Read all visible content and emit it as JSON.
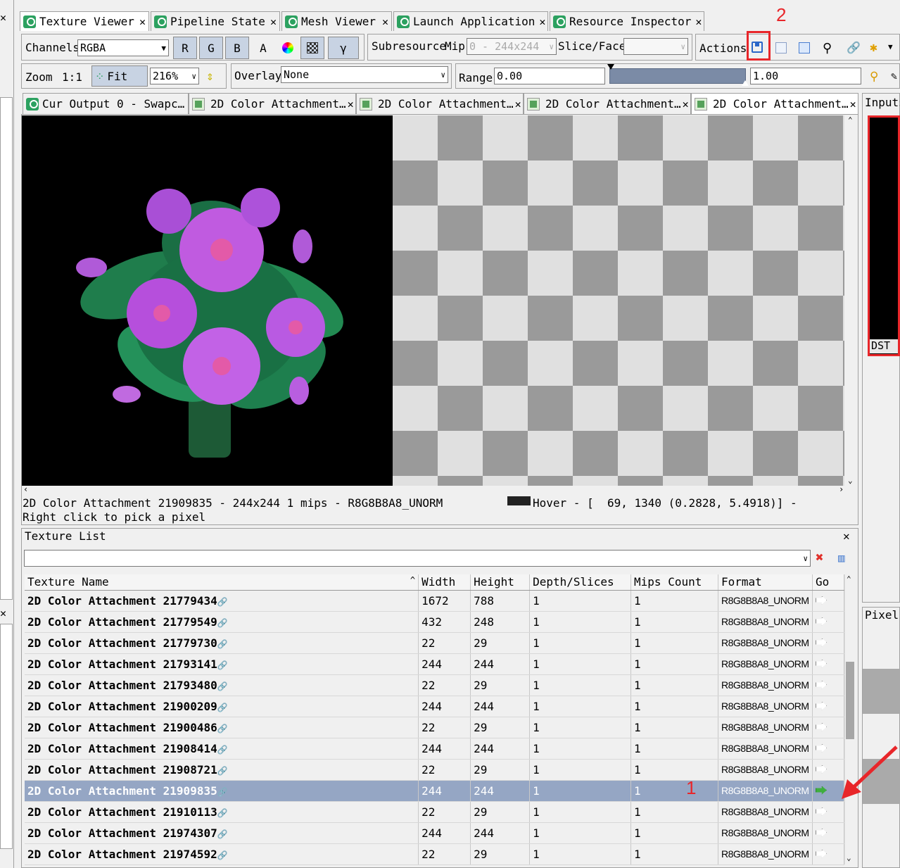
{
  "tabs": [
    {
      "label": "Texture Viewer"
    },
    {
      "label": "Pipeline State"
    },
    {
      "label": "Mesh Viewer"
    },
    {
      "label": "Launch Application"
    },
    {
      "label": "Resource Inspector"
    }
  ],
  "toolbar1": {
    "channels_label": "Channels",
    "channels_value": "RGBA",
    "r": "R",
    "g": "G",
    "b": "B",
    "a": "A",
    "gamma": "γ",
    "subresource_label": "Subresource",
    "mip_label": "Mip",
    "mip_value": "0 - 244x244",
    "slice_label": "Slice/Face",
    "actions_label": "Actions"
  },
  "toolbar2": {
    "zoom_label": "Zoom",
    "one_to_one": "1:1",
    "fit": "Fit",
    "zoom_value": "216%",
    "overlay_label": "Overlay",
    "overlay_value": "None",
    "range_label": "Range",
    "range_min": "0.00",
    "range_max": "1.00"
  },
  "view_tabs": [
    {
      "label": "Cur Output 0 - Swapc…"
    },
    {
      "label": "2D Color Attachment…"
    },
    {
      "label": "2D Color Attachment…"
    },
    {
      "label": "2D Color Attachment…"
    },
    {
      "label": "2D Color Attachment…"
    }
  ],
  "right_panel": {
    "inputs_label": "Inputs",
    "dst_label": "DST",
    "pixel_label": "Pixel"
  },
  "status": {
    "line1a": "2D Color Attachment 21909835 - 244x244 1 mips - R8G8B8A8_UNORM",
    "line1b": "Hover - [  69, 1340 (0.2828, 5.4918)] -",
    "line2": "Right click to pick a pixel"
  },
  "texture_list": {
    "title": "Texture List",
    "columns": [
      "Texture Name",
      "Width",
      "Height",
      "Depth/Slices",
      "Mips Count",
      "Format",
      "Go"
    ],
    "rows": [
      {
        "name": "2D Color Attachment 21779434",
        "width": "1672",
        "height": "788",
        "depth": "1",
        "mips": "1",
        "format": "R8G8B8A8_UNORM"
      },
      {
        "name": "2D Color Attachment 21779549",
        "width": "432",
        "height": "248",
        "depth": "1",
        "mips": "1",
        "format": "R8G8B8A8_UNORM"
      },
      {
        "name": "2D Color Attachment 21779730",
        "width": "22",
        "height": "29",
        "depth": "1",
        "mips": "1",
        "format": "R8G8B8A8_UNORM"
      },
      {
        "name": "2D Color Attachment 21793141",
        "width": "244",
        "height": "244",
        "depth": "1",
        "mips": "1",
        "format": "R8G8B8A8_UNORM"
      },
      {
        "name": "2D Color Attachment 21793480",
        "width": "22",
        "height": "29",
        "depth": "1",
        "mips": "1",
        "format": "R8G8B8A8_UNORM"
      },
      {
        "name": "2D Color Attachment 21900209",
        "width": "244",
        "height": "244",
        "depth": "1",
        "mips": "1",
        "format": "R8G8B8A8_UNORM"
      },
      {
        "name": "2D Color Attachment 21900486",
        "width": "22",
        "height": "29",
        "depth": "1",
        "mips": "1",
        "format": "R8G8B8A8_UNORM"
      },
      {
        "name": "2D Color Attachment 21908414",
        "width": "244",
        "height": "244",
        "depth": "1",
        "mips": "1",
        "format": "R8G8B8A8_UNORM"
      },
      {
        "name": "2D Color Attachment 21908721",
        "width": "22",
        "height": "29",
        "depth": "1",
        "mips": "1",
        "format": "R8G8B8A8_UNORM"
      },
      {
        "name": "2D Color Attachment 21909835",
        "width": "244",
        "height": "244",
        "depth": "1",
        "mips": "1",
        "format": "R8G8B8A8_UNORM",
        "selected": true
      },
      {
        "name": "2D Color Attachment 21910113",
        "width": "22",
        "height": "29",
        "depth": "1",
        "mips": "1",
        "format": "R8G8B8A8_UNORM"
      },
      {
        "name": "2D Color Attachment 21974307",
        "width": "244",
        "height": "244",
        "depth": "1",
        "mips": "1",
        "format": "R8G8B8A8_UNORM"
      },
      {
        "name": "2D Color Attachment 21974592",
        "width": "22",
        "height": "29",
        "depth": "1",
        "mips": "1",
        "format": "R8G8B8A8_UNORM"
      }
    ]
  },
  "annotations": {
    "label1": "1",
    "label2": "2",
    "color": "#e8262a"
  }
}
